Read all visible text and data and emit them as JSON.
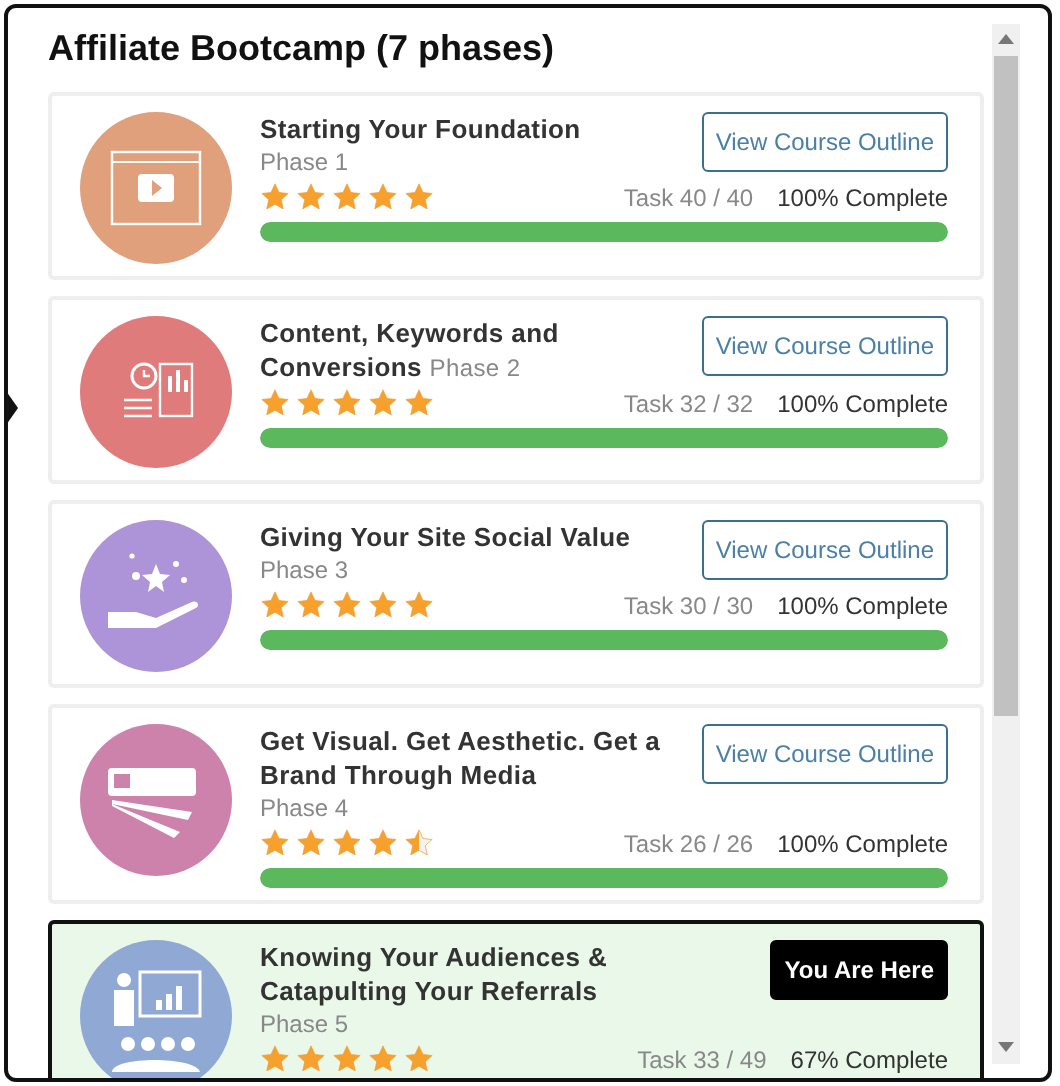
{
  "title": "Affiliate Bootcamp (7 phases)",
  "phases": [
    {
      "kind": "video",
      "color": "#e0a07c",
      "title": "Starting Your Foundation",
      "phase": "Phase 1",
      "phase_inline": false,
      "stars": 5,
      "task": "Task 40 / 40",
      "complete": "100% Complete",
      "level": 1,
      "current": false,
      "button": "View Course Outline"
    },
    {
      "kind": "report",
      "color": "#e07b7b",
      "title": "Content, Keywords and Conversions",
      "phase": "Phase 2",
      "phase_inline": true,
      "stars": 5,
      "task": "Task 32 / 32",
      "complete": "100% Complete",
      "level": 1,
      "current": false,
      "button": "View Course Outline"
    },
    {
      "kind": "hand",
      "color": "#ad94d8",
      "title": "Giving Your Site Social Value",
      "phase": "Phase 3",
      "phase_inline": false,
      "stars": 5,
      "task": "Task 30 / 30",
      "complete": "100% Complete",
      "level": 1,
      "current": false,
      "button": "View Course Outline"
    },
    {
      "kind": "swatch",
      "color": "#cc82aa",
      "title": "Get Visual. Get Aesthetic. Get a Brand Through Media",
      "phase": "Phase 4",
      "phase_inline": false,
      "stars": 4.5,
      "task": "Task 26 / 26",
      "complete": "100% Complete",
      "level": 1,
      "current": false,
      "button": "View Course Outline"
    },
    {
      "kind": "presenter",
      "color": "#8fa8d4",
      "title": "Knowing Your Audiences & Catapulting Your Referrals",
      "phase": "Phase 5",
      "phase_inline": false,
      "stars": 5,
      "task": "Task 33 / 49",
      "complete": "67% Complete",
      "current": true,
      "button": "You Are Here"
    }
  ]
}
